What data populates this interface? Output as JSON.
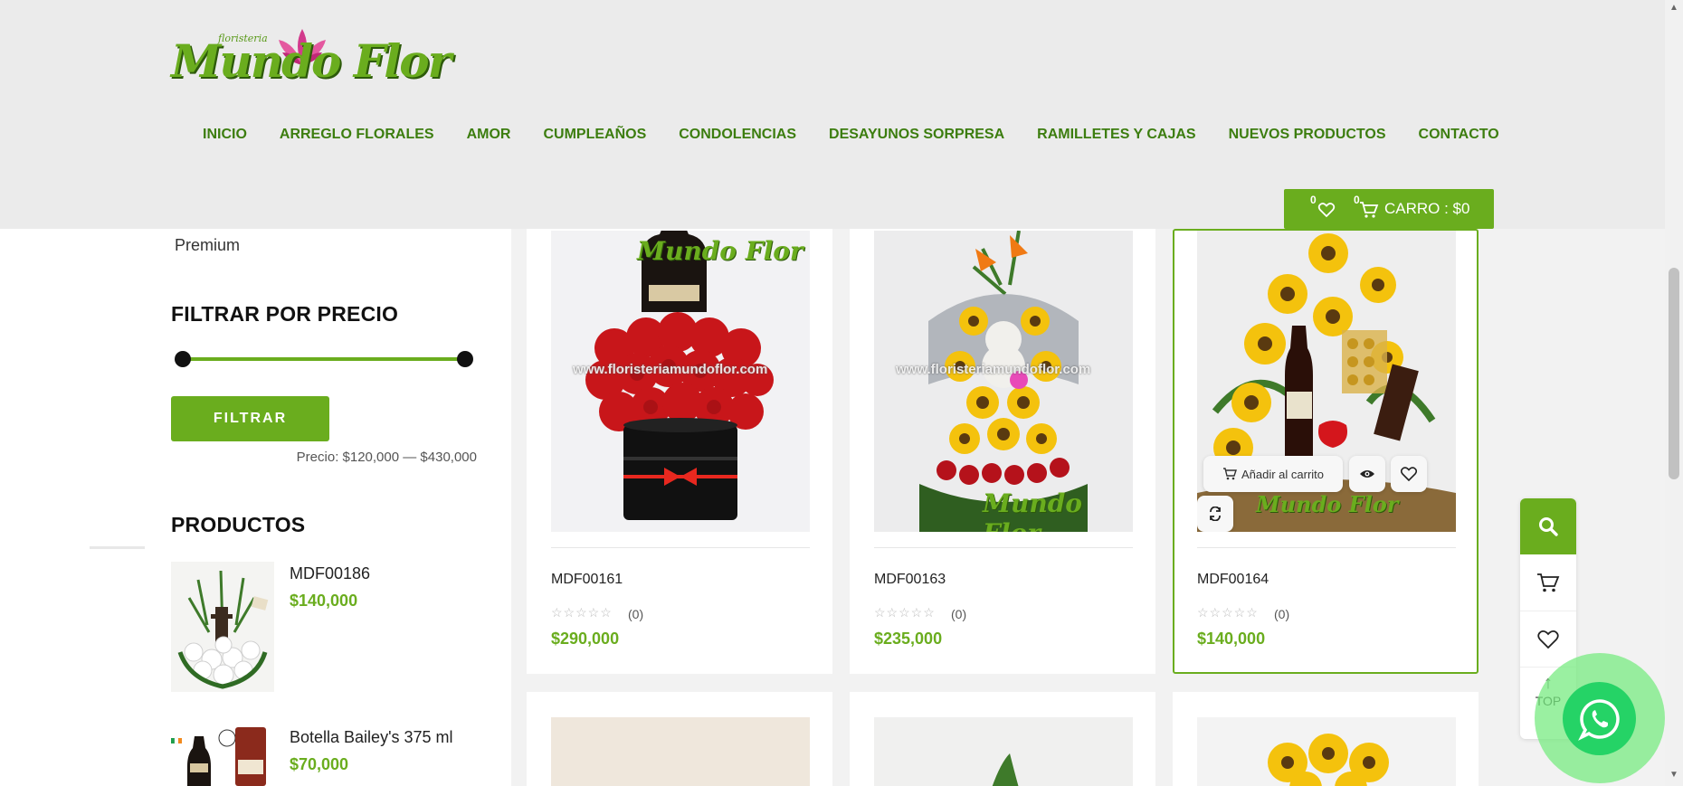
{
  "header": {
    "logo": {
      "tagline": "floristeria",
      "name": "Mundo Flor"
    },
    "nav": [
      {
        "label": "INICIO"
      },
      {
        "label": "ARREGLO FLORALES"
      },
      {
        "label": "AMOR"
      },
      {
        "label": "CUMPLEAÑOS"
      },
      {
        "label": "CONDOLENCIAS"
      },
      {
        "label": "DESAYUNOS SORPRESA"
      },
      {
        "label": "RAMILLETES Y CAJAS"
      },
      {
        "label": "NUEVOS PRODUCTOS"
      },
      {
        "label": "CONTACTO"
      }
    ],
    "wishlist_count": "0",
    "cart_count": "0",
    "cart_label": "CARRO : $0"
  },
  "sidebar": {
    "category_item": "Premium",
    "price_filter": {
      "title": "FILTRAR POR PRECIO",
      "button": "FILTRAR",
      "range_text": "Precio: $120,000 — $430,000",
      "min_fraction": 0,
      "max_fraction": 1
    },
    "products_title": "PRODUCTOS",
    "products": [
      {
        "name": "MDF00186",
        "price": "$140,000"
      },
      {
        "name": "Botella Bailey's 375 ml",
        "price": "$70,000"
      }
    ]
  },
  "products": [
    {
      "title": "MDF00161",
      "rating_count": "(0)",
      "price": "$290,000"
    },
    {
      "title": "MDF00163",
      "rating_count": "(0)",
      "price": "$235,000"
    },
    {
      "title": "MDF00164",
      "rating_count": "(0)",
      "price": "$140,000"
    }
  ],
  "product_actions": {
    "add_to_cart": "Añadir al carrito"
  },
  "watermark": {
    "brand": "Mundo Flor",
    "url": "www.floristeriamundoflor.com"
  },
  "float_panel": {
    "top_label": "TOP"
  },
  "colors": {
    "accent": "#6aad1e",
    "nav_text": "#3c7d0f",
    "whatsapp": "#25d366"
  }
}
